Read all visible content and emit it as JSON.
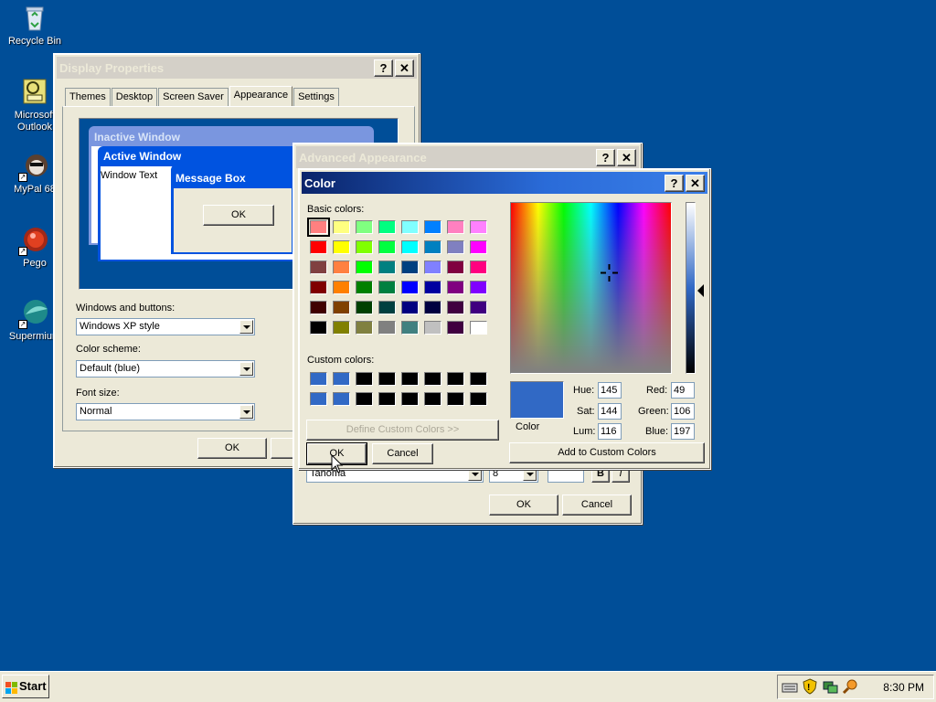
{
  "desktop": {
    "icons": [
      {
        "label": "Recycle Bin",
        "icon": "recycle-bin-icon"
      },
      {
        "label": "Microsoft Outlook",
        "line1": "Microsoft",
        "line2": "Outlook",
        "icon": "outlook-icon"
      },
      {
        "label": "MyPal 68",
        "icon": "mypal-icon"
      },
      {
        "label": "Pego",
        "icon": "pego-icon"
      },
      {
        "label": "Supermium",
        "icon": "supermium-icon"
      }
    ]
  },
  "display_properties": {
    "title": "Display Properties",
    "tabs": [
      "Themes",
      "Desktop",
      "Screen Saver",
      "Appearance",
      "Settings"
    ],
    "selected_tab": "Appearance",
    "preview": {
      "inactive_window": "Inactive Window",
      "active_window": "Active Window",
      "window_text": "Window Text",
      "message_box": "Message Box",
      "ok": "OK"
    },
    "windows_and_buttons_label": "Windows and buttons:",
    "windows_and_buttons_value": "Windows XP style",
    "color_scheme_label": "Color scheme:",
    "color_scheme_value": "Default (blue)",
    "font_size_label": "Font size:",
    "font_size_value": "Normal",
    "ok": "OK"
  },
  "advanced_appearance": {
    "title": "Advanced Appearance",
    "font_value": "Tahoma",
    "size_value": "8",
    "bold": "B",
    "italic": "I",
    "ok": "OK",
    "cancel": "Cancel"
  },
  "color_dialog": {
    "title": "Color",
    "basic_colors_label": "Basic colors:",
    "basic_colors": [
      "#ff8080",
      "#ffff80",
      "#80ff80",
      "#00ff80",
      "#80ffff",
      "#0080ff",
      "#ff80c0",
      "#ff80ff",
      "#ff0000",
      "#ffff00",
      "#80ff00",
      "#00ff40",
      "#00ffff",
      "#0080c0",
      "#8080c0",
      "#ff00ff",
      "#804040",
      "#ff8040",
      "#00ff00",
      "#008080",
      "#004080",
      "#8080ff",
      "#800040",
      "#ff0080",
      "#800000",
      "#ff8000",
      "#008000",
      "#008040",
      "#0000ff",
      "#0000a0",
      "#800080",
      "#8000ff",
      "#400000",
      "#804000",
      "#004000",
      "#004040",
      "#000080",
      "#000040",
      "#400040",
      "#400080",
      "#000000",
      "#808000",
      "#808040",
      "#808080",
      "#408080",
      "#c0c0c0",
      "#400040",
      "#ffffff"
    ],
    "custom_colors_label": "Custom colors:",
    "custom_colors": [
      "#3169c5",
      "#3169c5",
      "#000000",
      "#000000",
      "#000000",
      "#000000",
      "#000000",
      "#000000",
      "#3169c5",
      "#3169c5",
      "#000000",
      "#000000",
      "#000000",
      "#000000",
      "#000000",
      "#000000"
    ],
    "define_custom": "Define Custom Colors >>",
    "ok": "OK",
    "cancel": "Cancel",
    "color_label": "Color",
    "current_color": "#3169c5",
    "hue_label": "Hue:",
    "hue": "145",
    "sat_label": "Sat:",
    "sat": "144",
    "lum_label": "Lum:",
    "lum": "116",
    "red_label": "Red:",
    "red": "49",
    "green_label": "Green:",
    "green": "106",
    "blue_label": "Blue:",
    "blue": "197",
    "add_custom": "Add to Custom Colors"
  },
  "taskbar": {
    "start": "Start",
    "clock": "8:30 PM"
  }
}
